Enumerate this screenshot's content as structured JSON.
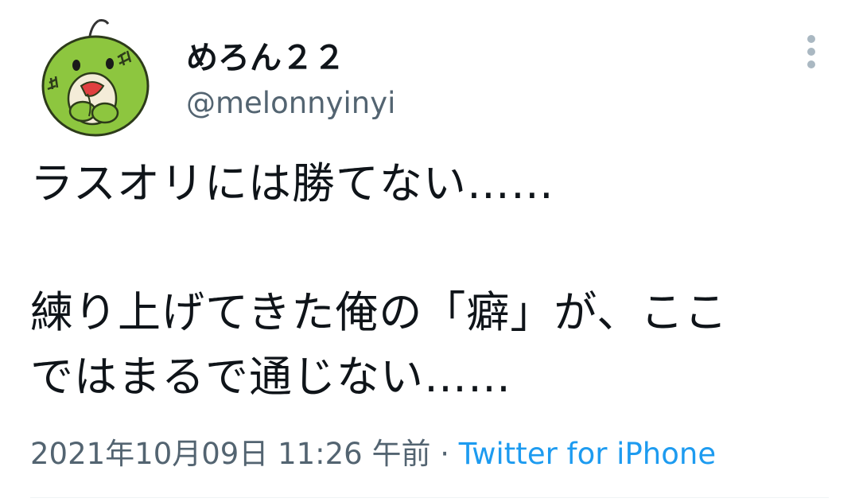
{
  "user": {
    "display_name": "めろん２２",
    "handle": "@melonnyinyi",
    "avatar_icon": "melon-character-avatar"
  },
  "tweet": {
    "lines": [
      "ラスオリには勝てない……",
      "",
      "練り上げてきた俺の「癖」が、ここ",
      "ではまるで通じない……"
    ],
    "timestamp": "2021年10月09日 11:26 午前",
    "separator": " · ",
    "source": "Twitter for iPhone"
  },
  "colors": {
    "text": "#0f1419",
    "secondary": "#536471",
    "link": "#1d9bf0",
    "avatar_green": "#8dc63f"
  },
  "icons": {
    "more": "more-vertical-icon"
  }
}
